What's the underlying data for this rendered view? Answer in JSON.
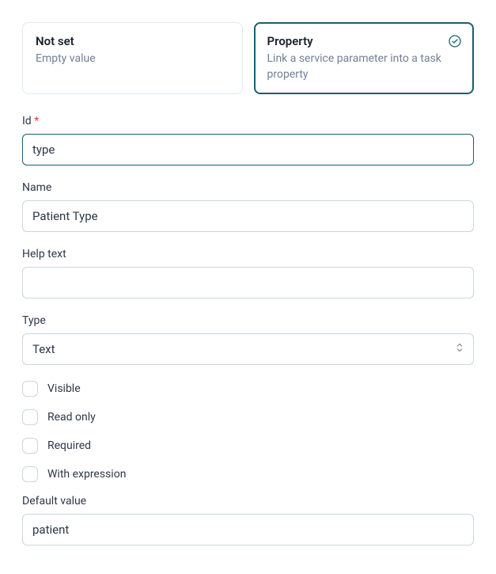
{
  "options": {
    "not_set": {
      "title": "Not set",
      "desc": "Empty value"
    },
    "property": {
      "title": "Property",
      "desc": "Link a service parameter into a task property"
    }
  },
  "fields": {
    "id": {
      "label": "Id",
      "value": "type",
      "required_marker": "*"
    },
    "name": {
      "label": "Name",
      "value": "Patient Type"
    },
    "help_text": {
      "label": "Help text",
      "value": ""
    },
    "type": {
      "label": "Type",
      "value": "Text"
    },
    "default_value": {
      "label": "Default value",
      "value": "patient"
    }
  },
  "checkboxes": {
    "visible": "Visible",
    "read_only": "Read only",
    "required": "Required",
    "with_expression": "With expression"
  }
}
